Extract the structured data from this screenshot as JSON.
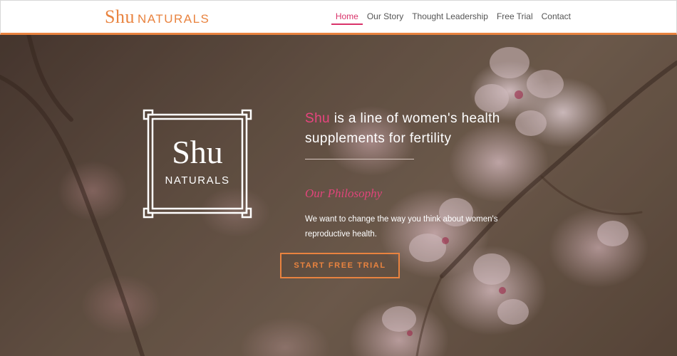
{
  "brand": {
    "logo_main": "Shu",
    "logo_sub": "NATURALS"
  },
  "nav": {
    "items": [
      {
        "label": "Home",
        "active": true
      },
      {
        "label": "Our Story",
        "active": false
      },
      {
        "label": "Thought Leadership",
        "active": false
      },
      {
        "label": "Free Trial",
        "active": false
      },
      {
        "label": "Contact",
        "active": false
      }
    ]
  },
  "hero": {
    "emblem_main": "Shu",
    "emblem_sub": "NATURALS",
    "headline_accent": "Shu",
    "headline_rest": " is a line of women's health supplements for fertility",
    "philosophy_heading": "Our Philosophy",
    "philosophy_body": "We want to change the way you think about women's reproductive health.",
    "cta_label": "START FREE TRIAL"
  },
  "colors": {
    "accent_orange": "#e9833f",
    "accent_pink": "#d9336a",
    "header_bg": "#ffffff"
  }
}
